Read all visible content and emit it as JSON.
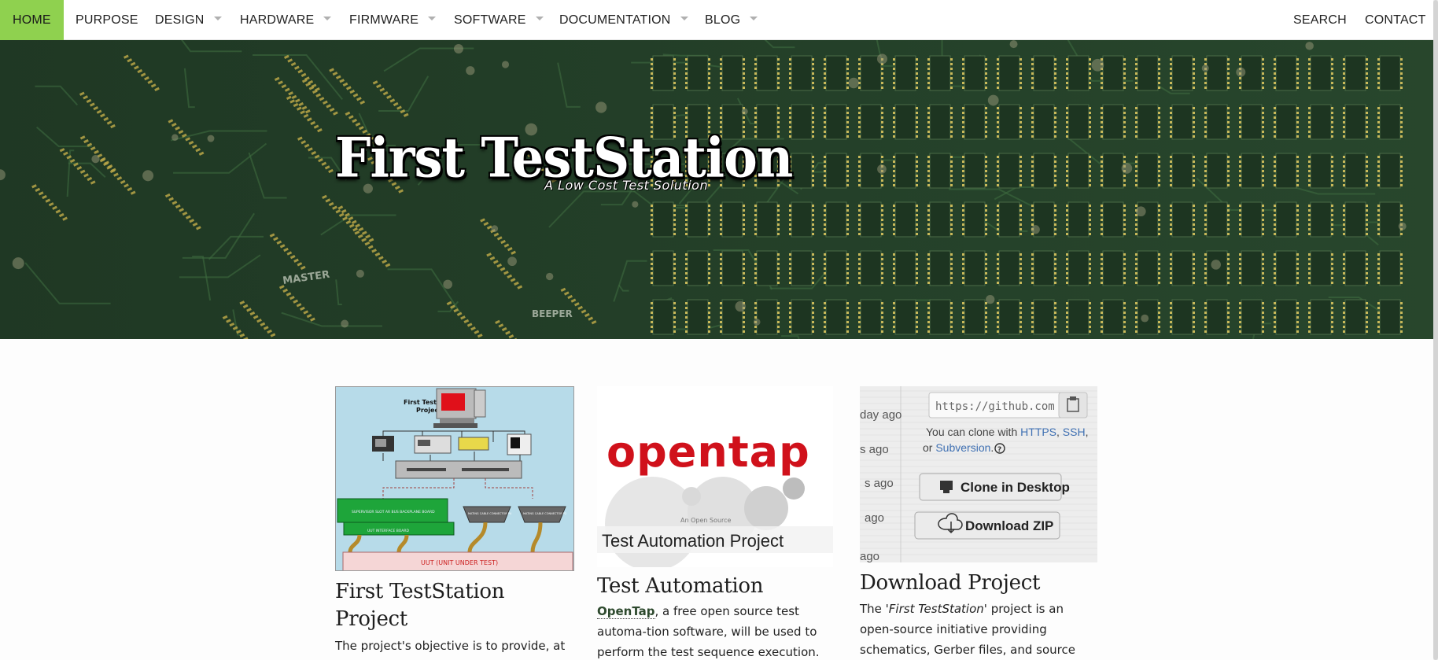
{
  "nav": {
    "home": "HOME",
    "purpose": "PURPOSE",
    "design": "DESIGN",
    "hardware": "HARDWARE",
    "firmware": "FIRMWARE",
    "software": "SOFTWARE",
    "documentation": "DOCUMENTATION",
    "blog": "BLOG",
    "search": "SEARCH",
    "contact": "CONTACT"
  },
  "hero": {
    "title": "First TestStation",
    "subtitle": "A Low Cost Test Solution",
    "board_labels": {
      "master": "MASTER",
      "beeper": "BEEPER"
    }
  },
  "cards": [
    {
      "title": "First TestStation Project",
      "text": "The project's objective is to provide, at a",
      "image": {
        "caption_title": "First TestStation",
        "caption_sub": "Project",
        "uut_label": "UUT (UNIT UNDER TEST)",
        "labels": [
          "SUPERVISOR SLOT AR BUS BACKPLANE BOARD",
          "UUT INTERFACE BOARD",
          "MATING CABLE CONNECTOR P4",
          "MATING CABLE CONNECTOR P2"
        ]
      }
    },
    {
      "title": "Test Automation",
      "link": "OpenTap",
      "text": ", a free open source test automa-tion software, will be used to perform the test sequence execution. The new software",
      "image": {
        "logo": "opentap",
        "small": "An Open Source",
        "banner": "Test Automation Project"
      }
    },
    {
      "title": "Download Project",
      "text_pre": "The '",
      "text_em": "First TestStation",
      "text_post": "' project is an open-source initiative providing schematics, Gerber files, and source code for a com-",
      "image": {
        "url": "https://github.com",
        "clone_prefix": "You can clone with ",
        "https": "HTTPS",
        "ssh": "SSH",
        "or": "or ",
        "subversion": "Subversion",
        "clone_btn": "Clone in Desktop",
        "zip_btn": "Download ZIP",
        "ago": [
          "day ago",
          "s ago",
          "s ago",
          "ago",
          "ago"
        ]
      }
    }
  ],
  "colors": {
    "nav_active": "#8fd14f",
    "hero_bg": "#223a22",
    "opentap_red": "#d0111b",
    "link_blue": "#4071b3"
  }
}
